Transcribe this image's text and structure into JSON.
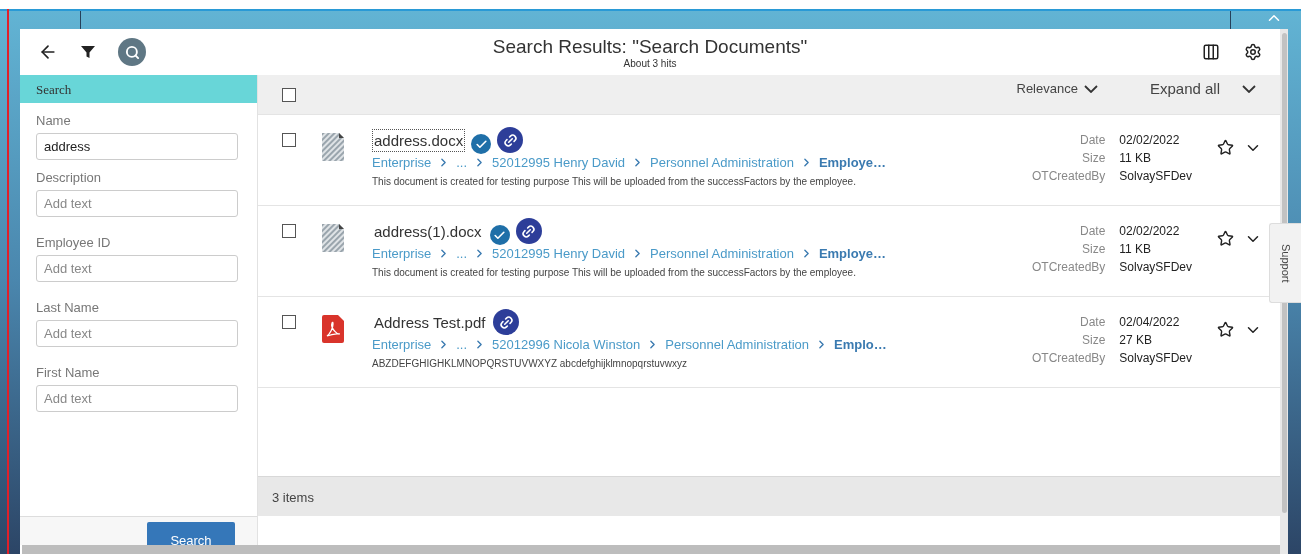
{
  "header": {
    "title": "Search Results: \"Search Documents\"",
    "subtitle": "About 3 hits"
  },
  "sidebar": {
    "title": "Search",
    "fields": [
      {
        "label": "Name",
        "value": "address"
      },
      {
        "label": "Description",
        "placeholder": "Add text"
      },
      {
        "label": "Employee ID",
        "placeholder": "Add text"
      },
      {
        "label": "Last Name",
        "placeholder": "Add text"
      },
      {
        "label": "First Name",
        "placeholder": "Add text"
      }
    ],
    "button": "Search"
  },
  "results": {
    "select_all_checked": false,
    "sort": "Relevance",
    "expand": "Expand all",
    "rows": [
      {
        "kind": "docx",
        "name": "address.docx",
        "focused": true,
        "verified": true,
        "checked": false,
        "starred": false,
        "path": [
          "Enterprise",
          "...",
          "52012995 Henry David",
          "Personnel Administration",
          "Employe…"
        ],
        "description": "This document is created for testing purpose This will be uploaded from the successFactors by the employee.",
        "meta": [
          {
            "label": "Date",
            "value": "02/02/2022"
          },
          {
            "label": "Size",
            "value": "11 KB"
          },
          {
            "label": "OTCreatedBy",
            "value": "SolvaySFDev"
          }
        ]
      },
      {
        "kind": "docx",
        "name": "address(1).docx",
        "focused": false,
        "verified": true,
        "checked": false,
        "starred": false,
        "path": [
          "Enterprise",
          "...",
          "52012995 Henry David",
          "Personnel Administration",
          "Employe…"
        ],
        "description": "This document is created for testing purpose This will be uploaded from the successFactors by the employee.",
        "meta": [
          {
            "label": "Date",
            "value": "02/02/2022"
          },
          {
            "label": "Size",
            "value": "11 KB"
          },
          {
            "label": "OTCreatedBy",
            "value": "SolvaySFDev"
          }
        ]
      },
      {
        "kind": "pdf",
        "name": "Address Test.pdf",
        "focused": false,
        "verified": false,
        "checked": false,
        "starred": false,
        "path": [
          "Enterprise",
          "...",
          "52012996 Nicola Winston",
          "Personnel Administration",
          "Emplo…"
        ],
        "description": "ABZDEFGHIGHKLMNOPQRSTUVWXYZ abcdefghijklmnopqrstuvwxyz",
        "meta": [
          {
            "label": "Date",
            "value": "02/04/2022"
          },
          {
            "label": "Size",
            "value": "27 KB"
          },
          {
            "label": "OTCreatedBy",
            "value": "SolvaySFDev"
          }
        ]
      }
    ],
    "footer": "3 items"
  },
  "support_tab": "Support"
}
